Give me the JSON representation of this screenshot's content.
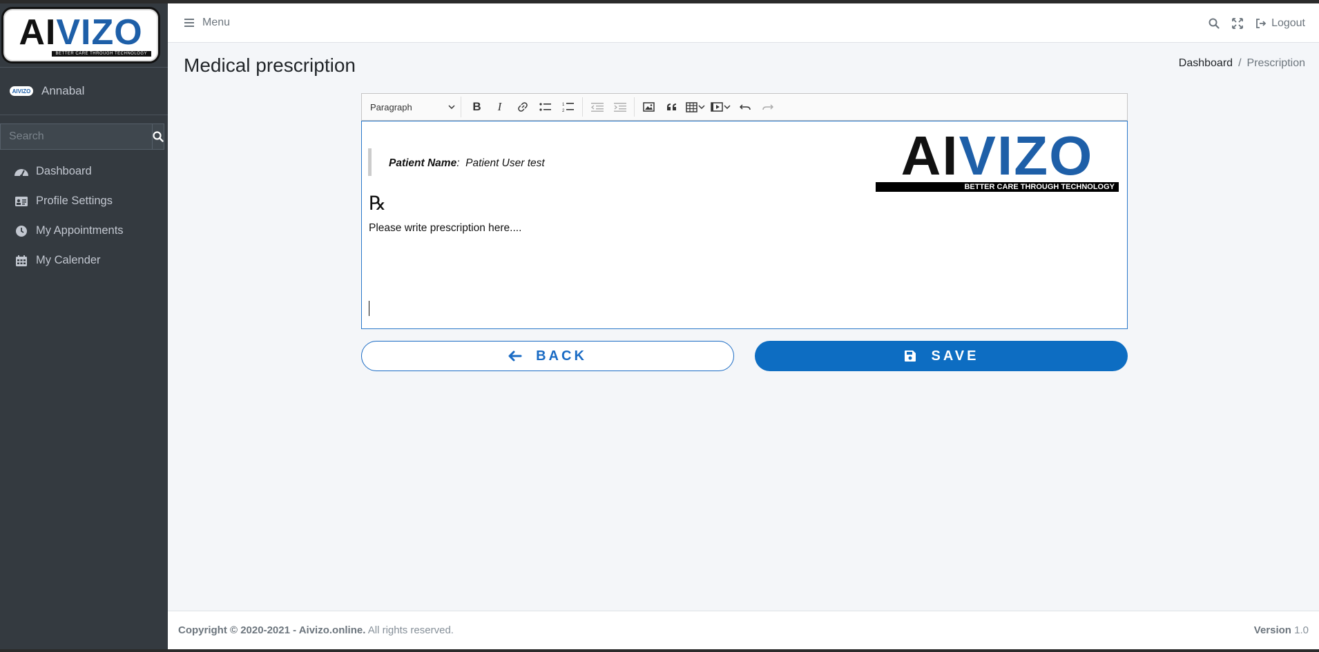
{
  "sidebar": {
    "logo_text_ai": "AI",
    "logo_text_vizo": "VIZO",
    "logo_tagline": "BETTER CARE THROUGH TECHNOLOGY",
    "user_avatar_text": "AIVIZO",
    "user_name": "Annabal",
    "search_placeholder": "Search",
    "items": [
      {
        "label": "Dashboard",
        "icon": "dashboard-icon"
      },
      {
        "label": "Profile Settings",
        "icon": "id-card-icon"
      },
      {
        "label": "My Appointments",
        "icon": "clock-icon"
      },
      {
        "label": "My Calender",
        "icon": "calendar-icon"
      }
    ]
  },
  "navbar": {
    "menu_label": "Menu",
    "logout_label": "Logout"
  },
  "page": {
    "title": "Medical prescription",
    "breadcrumb": [
      "Dashboard",
      "Prescription"
    ]
  },
  "editor": {
    "paragraph_select": "Paragraph",
    "patient_label": "Patient Name",
    "patient_value": "Patient User test",
    "rx_symbol": "℞",
    "prescription_text": "Please write prescription here....",
    "logo_text_ai": "AI",
    "logo_text_vizo": "VIZO",
    "logo_tagline": "BETTER CARE THROUGH TECHNOLOGY"
  },
  "buttons": {
    "back_label": "BACK",
    "save_label": "SAVE"
  },
  "footer": {
    "copyright": "Copyright © 2020-2021 - Aivizo.online.",
    "rights": "All rights reserved.",
    "version_label": "Version",
    "version_value": "1.0"
  },
  "colors": {
    "accent": "#0d6dc2",
    "sidebar_bg": "#343a40",
    "page_bg": "#f4f6f9"
  }
}
